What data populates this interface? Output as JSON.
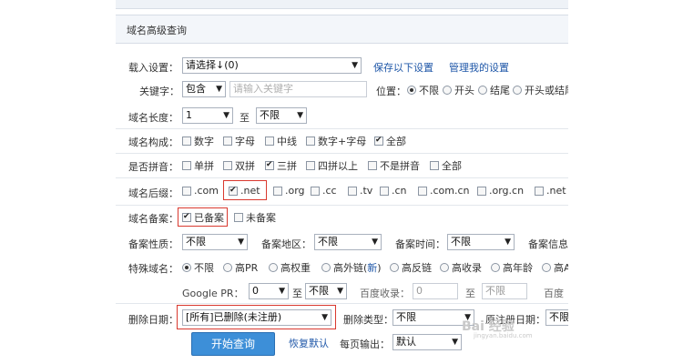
{
  "panel_title": "域名高级查询",
  "load": {
    "label": "载入设置：",
    "value": "请选择↓(0)",
    "save_link": "保存以下设置",
    "manage_link": "管理我的设置"
  },
  "keyword": {
    "label": "关键字：",
    "mode": "包含",
    "placeholder": "请输入关键字",
    "position_label": "位置：",
    "positions": [
      {
        "label": "不限",
        "checked": true
      },
      {
        "label": "开头",
        "checked": false
      },
      {
        "label": "结尾",
        "checked": false
      },
      {
        "label": "开头或结尾",
        "checked": false
      }
    ]
  },
  "length": {
    "label": "域名长度：",
    "from": "1",
    "to_label": "至",
    "to": "不限"
  },
  "composition": {
    "label": "域名构成：",
    "options": [
      {
        "label": "数字",
        "checked": false
      },
      {
        "label": "字母",
        "checked": false
      },
      {
        "label": "中线",
        "checked": false
      },
      {
        "label": "数字+字母",
        "checked": false
      },
      {
        "label": "全部",
        "checked": true
      }
    ]
  },
  "pinyin": {
    "label": "是否拼音：",
    "options": [
      {
        "label": "单拼",
        "checked": false
      },
      {
        "label": "双拼",
        "checked": false
      },
      {
        "label": "三拼",
        "checked": true
      },
      {
        "label": "四拼以上",
        "checked": false
      },
      {
        "label": "不是拼音",
        "checked": false
      },
      {
        "label": "全部",
        "checked": false
      }
    ]
  },
  "suffix": {
    "label": "域名后缀：",
    "options": [
      {
        "label": ".com",
        "checked": false
      },
      {
        "label": ".net",
        "checked": true
      },
      {
        "label": ".org",
        "checked": false
      },
      {
        "label": ".cc",
        "checked": false
      },
      {
        "label": ".tv",
        "checked": false
      },
      {
        "label": ".cn",
        "checked": false
      },
      {
        "label": ".com.cn",
        "checked": false
      },
      {
        "label": ".org.cn",
        "checked": false
      },
      {
        "label": ".net",
        "checked": false
      }
    ]
  },
  "record": {
    "label": "域名备案：",
    "options": [
      {
        "label": "已备案",
        "checked": true
      },
      {
        "label": "未备案",
        "checked": false
      }
    ]
  },
  "record_detail": {
    "nature_label": "备案性质：",
    "nature": "不限",
    "area_label": "备案地区：",
    "area": "不限",
    "time_label": "备案时间：",
    "time": "不限",
    "info_label": "备案信息"
  },
  "special": {
    "label": "特殊域名：",
    "options": [
      {
        "label": "不限",
        "checked": true
      },
      {
        "label": "高PR",
        "checked": false
      },
      {
        "label": "高权重",
        "checked": false
      },
      {
        "label": "高外链(",
        "checked": false
      },
      {
        "label": "高反链",
        "checked": false
      },
      {
        "label": "高收录",
        "checked": false
      },
      {
        "label": "高年龄",
        "checked": false
      },
      {
        "label": "高A",
        "checked": false
      }
    ],
    "new_tag": "新",
    "close_paren": ")"
  },
  "pr": {
    "label": "Google PR：",
    "from": "0",
    "to_label": "至",
    "to": "不限",
    "baidu_label": "百度收录：",
    "baidu_from": "0",
    "baidu_to_label": "至",
    "baidu_to": "不限",
    "baidu_trunc": "百度"
  },
  "delete": {
    "label": "删除日期：",
    "value": "[所有]已删除(未注册)",
    "type_label": "删除类型：",
    "type": "不限",
    "orig_label": "原注册日期：",
    "orig": "不限"
  },
  "actions": {
    "search": "开始查询",
    "reset": "恢复默认",
    "per_page_label": "每页输出：",
    "per_page": "默认"
  },
  "watermark": {
    "main": "Bai 经验",
    "sub": "jingyan.baidu.com"
  },
  "colors": {
    "link": "#1f57a8",
    "button": "#3d8fd8",
    "highlight": "#d9392f"
  }
}
